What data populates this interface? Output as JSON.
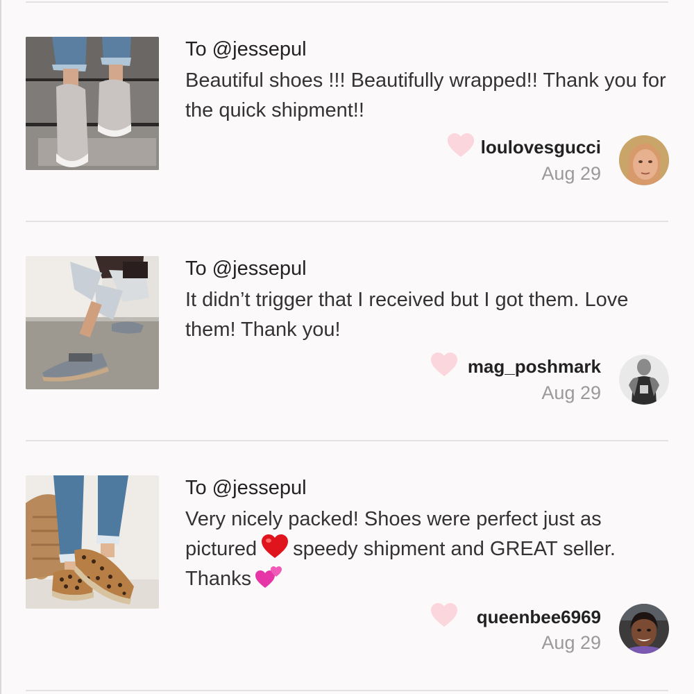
{
  "reviews": [
    {
      "recipient": "To @jessepul",
      "message": "Beautiful shoes !!! Beautifully wrapped!! Thank you for the quick shipment!!",
      "username": "loulovesgucci",
      "date": "Aug 29",
      "thumb_icon": "gray-slip-on-sneakers-image",
      "avatar_icon": "user-avatar-image"
    },
    {
      "recipient": "To @jessepul",
      "message": "It didn’t trigger that I received but I got them. Love them! Thank you!",
      "username": "mag_poshmark",
      "date": "Aug 29",
      "thumb_icon": "gray-mule-shoes-image",
      "avatar_icon": "user-avatar-image"
    },
    {
      "recipient": "To @jessepul",
      "message_part1": "Very nicely packed! Shoes were perfect just as pictured",
      "message_part2": "speedy shipment and GREAT seller. Thanks",
      "username": "queenbee6969",
      "date": "Aug 29",
      "thumb_icon": "leopard-espadrille-shoes-image",
      "avatar_icon": "user-avatar-image"
    }
  ],
  "colors": {
    "background": "#fbf9fa",
    "heart": "#fbd6dc",
    "date_text": "#9a9a9a",
    "divider": "#e3e1e2"
  },
  "icons": {
    "like": "heart-icon",
    "emoji1": "red-heart-emoji",
    "emoji2": "two-hearts-emoji"
  }
}
